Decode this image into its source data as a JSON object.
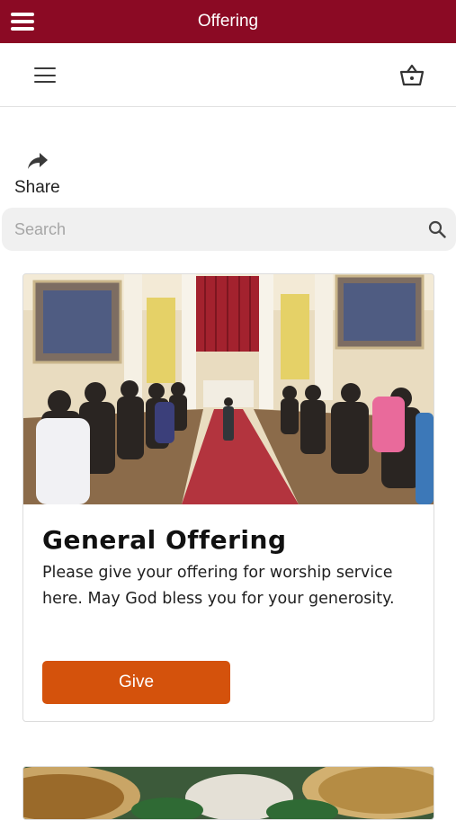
{
  "header": {
    "title": "Offering"
  },
  "share": {
    "label": "Share"
  },
  "search": {
    "placeholder": "Search"
  },
  "offerings": [
    {
      "title": "General Offering",
      "description": "Please give your offering for worship service here. May God bless you for your generosity.",
      "button_label": "Give"
    }
  ],
  "colors": {
    "header_bg": "#8b0a24",
    "button_bg": "#d4520c",
    "search_bg": "#f0f0f0"
  }
}
